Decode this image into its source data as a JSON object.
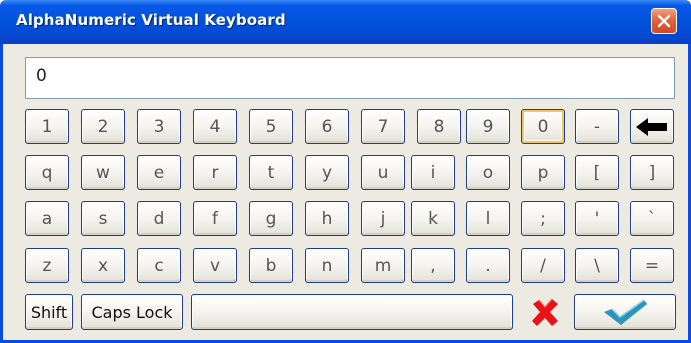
{
  "window": {
    "title": "AlphaNumeric Virtual Keyboard",
    "close_icon": "close-icon"
  },
  "display": {
    "value": "0"
  },
  "rows": {
    "row1": [
      "1",
      "2",
      "3",
      "4",
      "5",
      "6",
      "7",
      "8",
      "9",
      "0",
      "-"
    ],
    "row2": [
      "q",
      "w",
      "e",
      "r",
      "t",
      "y",
      "u",
      "i",
      "o",
      "p",
      "[",
      "]"
    ],
    "row3": [
      "a",
      "s",
      "d",
      "f",
      "g",
      "h",
      "j",
      "k",
      "l",
      ";",
      "'",
      "`"
    ],
    "row4": [
      "z",
      "x",
      "c",
      "v",
      "b",
      "n",
      "m",
      ",",
      ".",
      "/",
      "\\",
      "="
    ]
  },
  "bottom": {
    "shift_label": "Shift",
    "caps_label": "Caps Lock",
    "space_label": "",
    "cancel_icon": "red-x-icon",
    "ok_icon": "checkmark-icon"
  },
  "icons": {
    "backspace": "backspace-arrow-icon"
  },
  "colors": {
    "title_bar": "#0150d9",
    "key_border": "#1f3d88",
    "cancel_red": "#e8131a",
    "ok_teal": "#2b95b7"
  }
}
